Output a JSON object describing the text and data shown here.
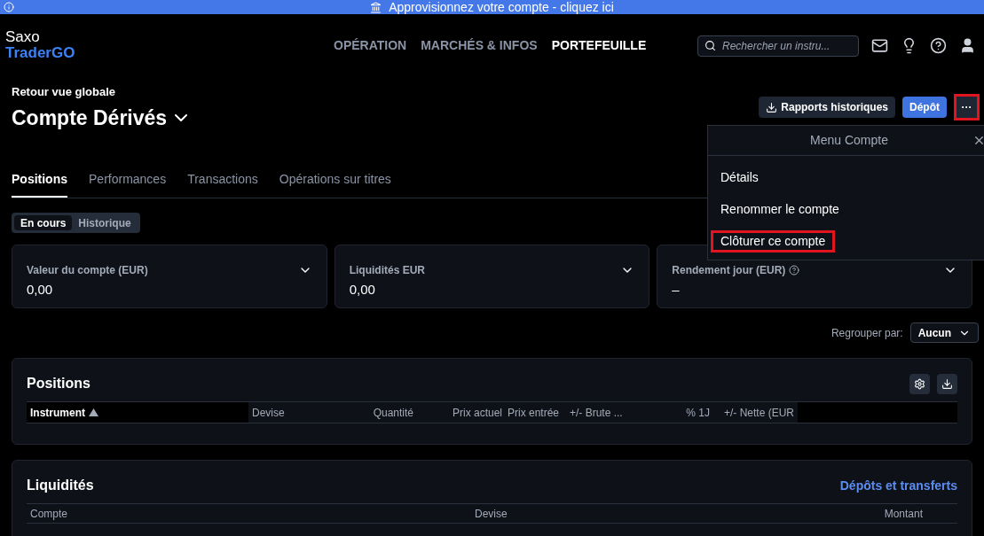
{
  "banner": {
    "text": "Approvisionnez votre compte - cliquez ici"
  },
  "logo": {
    "line1": "Saxo",
    "line2": "TraderGO"
  },
  "nav": [
    {
      "label": "OPÉRATION",
      "selected": false
    },
    {
      "label": "MARCHÉS & INFOS",
      "selected": false
    },
    {
      "label": "PORTEFEUILLE",
      "selected": true
    }
  ],
  "search": {
    "placeholder": "Rechercher un instru..."
  },
  "back_link": "Retour vue globale",
  "account_title": "Compte Dérivés",
  "actions": {
    "reports": "Rapports historiques",
    "deposit": "Dépôt",
    "more": "···",
    "more_highlighted": true
  },
  "tabs": [
    {
      "label": "Positions",
      "selected": true
    },
    {
      "label": "Performances",
      "selected": false
    },
    {
      "label": "Transactions",
      "selected": false
    },
    {
      "label": "Opérations sur titres",
      "selected": false
    }
  ],
  "segments": [
    {
      "label": "En cours",
      "selected": true
    },
    {
      "label": "Historique",
      "selected": false
    }
  ],
  "cards": [
    {
      "label": "Valeur du compte (EUR)",
      "value": "0,00",
      "info": false
    },
    {
      "label": "Liquidités EUR",
      "value": "0,00",
      "info": false
    },
    {
      "label": "Rendement jour (EUR)",
      "value": "–",
      "info": true
    }
  ],
  "group_by": {
    "label": "Regrouper par:",
    "value": "Aucun"
  },
  "positions": {
    "title": "Positions",
    "columns": [
      "Instrument",
      "Devise",
      "Quantité",
      "Prix actuel",
      "Prix entrée",
      "+/- Brute ...",
      "% 1J",
      "+/- Nette (EUR"
    ]
  },
  "liquidity": {
    "title": "Liquidités",
    "link": "Dépôts et transferts",
    "columns": [
      "Compte",
      "Devise",
      "Montant"
    ]
  },
  "menu": {
    "title": "Menu Compte",
    "items": [
      {
        "label": "Détails",
        "highlighted": false
      },
      {
        "label": "Renommer le compte",
        "highlighted": false
      },
      {
        "label": "Clôturer ce compte",
        "highlighted": true
      }
    ]
  }
}
